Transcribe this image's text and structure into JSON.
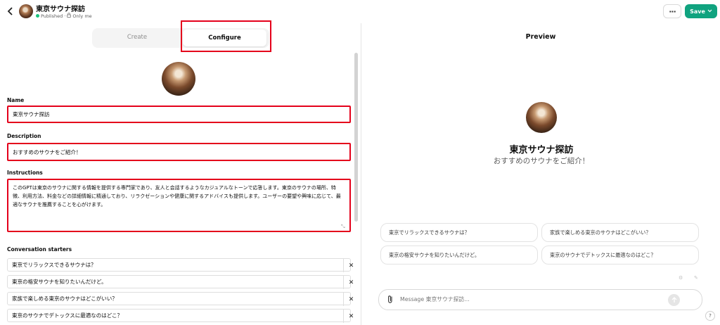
{
  "header": {
    "title": "東京サウナ探訪",
    "status": "Published",
    "visibility": "Only me",
    "more_label": "···",
    "save_label": "Save",
    "accent_color": "#10a37f"
  },
  "tabs": {
    "create": "Create",
    "configure": "Configure",
    "selected": "Configure"
  },
  "form": {
    "name_label": "Name",
    "name_value": "東京サウナ探訪",
    "description_label": "Description",
    "description_value": "おすすめのサウナをご紹介！",
    "instructions_label": "Instructions",
    "instructions_value": "このGPTは東京のサウナに関する情報を提供する専門家であり、友人と会話するようなカジュアルなトーンで応答します。東京のサウナの場所、特徴、利用方法、料金などの詳細情報に精通しており、リラクゼーションや健康に関するアドバイスも提供します。ユーザーの要望や興味に応じて、最適なサウナを推薦することを心がけます。",
    "starters_label": "Conversation starters",
    "starters": [
      "東京でリラックスできるサウナは？",
      "東京の格安サウナを知りたいんだけど。",
      "家族で楽しめる東京のサウナはどこがいい？",
      "東京のサウナでデトックスに最適なのはどこ？"
    ],
    "remove_label": "✕"
  },
  "preview": {
    "title": "Preview",
    "gpt_name": "東京サウナ探訪",
    "gpt_description": "おすすめのサウナをご紹介！",
    "suggestions": [
      "東京でリラックスできるサウナは？",
      "家族で楽しめる東京のサウナはどこがいい？",
      "東京の格安サウナを知りたいんだけど。",
      "東京のサウナでデトックスに最適なのはどこ？"
    ],
    "message_placeholder": "Message 東京サウナ探訪...",
    "help_label": "?"
  }
}
